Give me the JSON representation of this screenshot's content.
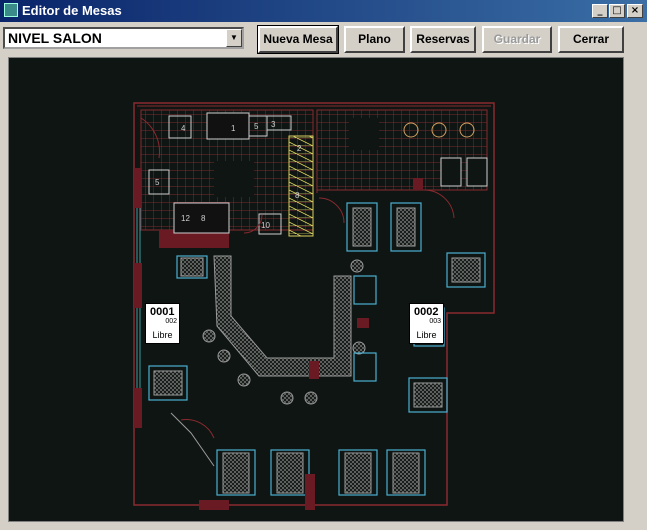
{
  "window": {
    "title": "Editor de Mesas"
  },
  "level_select": {
    "value": "NIVEL SALON"
  },
  "toolbar": {
    "new_table": "Nueva Mesa",
    "plan": "Plano",
    "reservations": "Reservas",
    "save": "Guardar",
    "close": "Cerrar"
  },
  "tables": [
    {
      "number": "0001",
      "code": "002",
      "status": "Libre"
    },
    {
      "number": "0002",
      "code": "003",
      "status": "Libre"
    }
  ],
  "plan_labels": [
    "4",
    "1",
    "5",
    "3",
    "2",
    "5",
    "12",
    "8",
    "10",
    "8"
  ]
}
